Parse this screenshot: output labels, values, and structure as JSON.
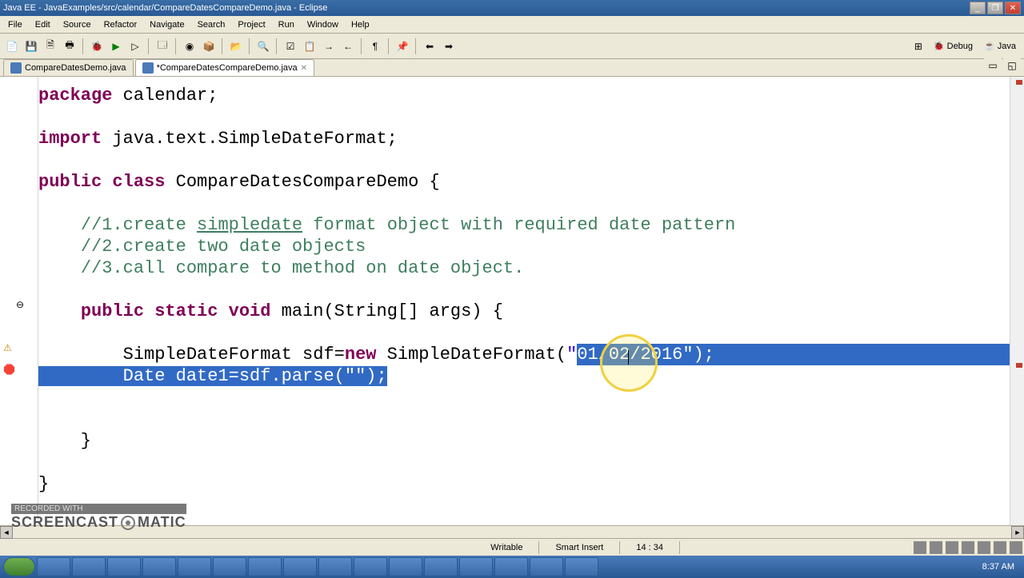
{
  "window": {
    "title": "Java EE - JavaExamples/src/calendar/CompareDatesCompareDemo.java - Eclipse"
  },
  "menu": {
    "file": "File",
    "edit": "Edit",
    "source": "Source",
    "refactor": "Refactor",
    "navigate": "Navigate",
    "search": "Search",
    "project": "Project",
    "run": "Run",
    "window": "Window",
    "help": "Help"
  },
  "perspective": {
    "debug": "Debug",
    "java": "Java"
  },
  "tabs": {
    "tab1": "CompareDatesDemo.java",
    "tab2": "*CompareDatesCompareDemo.java"
  },
  "code": {
    "l1_kw_package": "package",
    "l1_rest": " calendar;",
    "l3_kw_import": "import",
    "l3_rest": " java.text.SimpleDateFormat;",
    "l5_kw1": "public",
    "l5_kw2": "class",
    "l5_rest": " CompareDatesCompareDemo {",
    "l7_comment": "//1.create ",
    "l7_comment_u": "simpledate",
    "l7_comment2": " format object with required date pattern",
    "l8_comment": "//2.create two date objects",
    "l9_comment": "//3.call compare to method on date object.",
    "l11_kw1": "public",
    "l11_kw2": "static",
    "l11_kw3": "void",
    "l11_rest": " main(String[] args) {",
    "l13_plain": "        SimpleDateFormat sdf=",
    "l13_kw_new": "new",
    "l13_plain2": " SimpleDateFormat(",
    "l13_str_q": "\"",
    "l13_sel": "01/02/2016",
    "l13_sel_after": "\");",
    "l14_sel": "        Date date1=sdf.parse(\"\");",
    "l17_brace": "    }",
    "l19_brace": "}"
  },
  "status": {
    "writable": "Writable",
    "insert": "Smart Insert",
    "position": "14 : 34"
  },
  "taskbar": {
    "time": "8:37 AM"
  },
  "watermark": {
    "rec": "RECORDED WITH",
    "brand1": "SCREENCAST",
    "brand2": "MATIC"
  }
}
